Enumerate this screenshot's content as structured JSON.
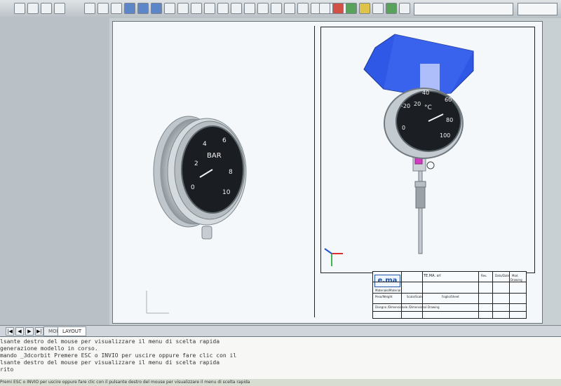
{
  "gauge_left": {
    "unit": "BAR",
    "ticks": [
      "0",
      "2",
      "4",
      "6",
      "8",
      "10"
    ]
  },
  "gauge_right": {
    "unit": "°C",
    "ticks": [
      "-20",
      "0",
      "20",
      "40",
      "60",
      "80",
      "100"
    ]
  },
  "title_block": {
    "logo": "e.ma",
    "company": "TE.MA. srl",
    "rev_header": "Rev.",
    "date_header": "Data/Date",
    "mod_header": "Mod.",
    "drawing_label": "Drawing",
    "material_label": "Materiale/Material",
    "weight_label": "Peso/Weight",
    "scale_label": "Scala/Scale",
    "sheet_label": "Foglio/Sheet",
    "row_lines": [
      "Disegno /Dimensionale /Dimensional Drawing"
    ]
  },
  "tabs": {
    "model": "MODEL",
    "layout": "LAYOUT"
  },
  "command_lines": [
    "lsante destro del mouse per visualizzare il menu di scelta rapida",
    "generazione modello in corso.",
    "mando   _3dcorbit Premere ESC o INVIO per uscire oppure fare clic con il",
    "lsante destro del mouse per visualizzare il menu di scelta rapida",
    "rito"
  ],
  "status_line": "Premi ESC o INVIO per uscire oppure fare clic con il pulsante destro del mouse per visualizzare il menu di scelta rapida"
}
